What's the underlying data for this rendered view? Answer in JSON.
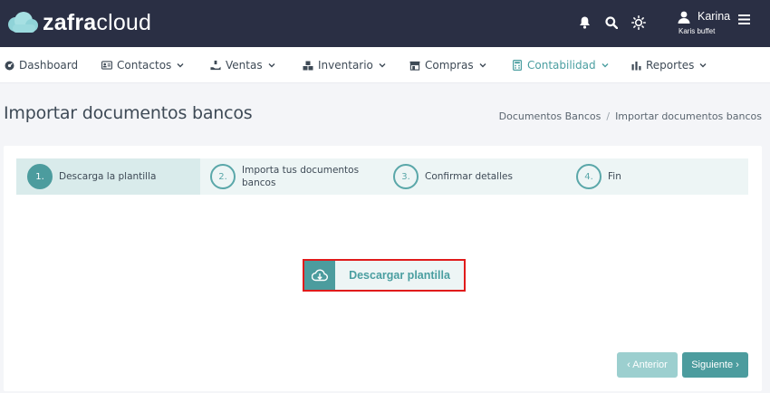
{
  "brand": {
    "name_bold": "zafra",
    "name_light": "cloud"
  },
  "user": {
    "name": "Karina",
    "subtitle": "Karis buffet"
  },
  "nav": {
    "items": [
      {
        "label": "Dashboard"
      },
      {
        "label": "Contactos"
      },
      {
        "label": "Ventas"
      },
      {
        "label": "Inventario"
      },
      {
        "label": "Compras"
      },
      {
        "label": "Contabilidad"
      },
      {
        "label": "Reportes"
      }
    ]
  },
  "page": {
    "title": "Importar documentos bancos"
  },
  "breadcrumb": {
    "items": [
      "Documentos Bancos",
      "Importar documentos bancos"
    ],
    "separator": "/"
  },
  "steps": [
    {
      "num": "1.",
      "label": "Descarga la plantilla"
    },
    {
      "num": "2.",
      "label_line1": "Importa tus documentos",
      "label_line2": "bancos"
    },
    {
      "num": "3.",
      "label": "Confirmar detalles"
    },
    {
      "num": "4.",
      "label": "Fin"
    }
  ],
  "download": {
    "label": "Descargar plantilla"
  },
  "buttons": {
    "prev": "‹ Anterior",
    "next": "Siguiente ›"
  },
  "colors": {
    "topbar": "#2a2f44",
    "accent": "#4c9c9e",
    "highlight": "#e01b1b"
  },
  "icons": {
    "logo": "cloud-logo-icon",
    "bell": "bell-icon",
    "search": "search-icon",
    "theme": "sun-icon",
    "user": "user-icon",
    "menu": "hamburger-menu-icon"
  }
}
